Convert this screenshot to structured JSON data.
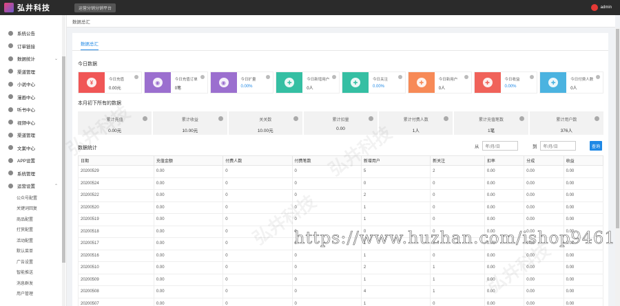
{
  "header": {
    "brand": "弘井科技",
    "platform_tag": "运营分销分销平台",
    "user": "admin"
  },
  "breadcrumb": "数据总汇",
  "sidebar": {
    "items": [
      {
        "label": "系统公告",
        "chev": ""
      },
      {
        "label": "订单链接",
        "chev": ""
      },
      {
        "label": "数据统计",
        "chev": "⌄"
      },
      {
        "label": "渠道管理",
        "chev": ""
      },
      {
        "label": "小说中心",
        "chev": ""
      },
      {
        "label": "漫画中心",
        "chev": ""
      },
      {
        "label": "听书中心",
        "chev": ""
      },
      {
        "label": "视频中心",
        "chev": ""
      },
      {
        "label": "渠道管理",
        "chev": ""
      },
      {
        "label": "文案中心",
        "chev": ""
      },
      {
        "label": "APP设置",
        "chev": ""
      },
      {
        "label": "系统管理",
        "chev": ""
      },
      {
        "label": "运营设置",
        "chev": "⌃"
      }
    ],
    "sub_items": [
      "公众号配置",
      "关键词回复",
      "商品配置",
      "打赏配置",
      "活动配置",
      "默认菜单",
      "广告设置",
      "智能推送",
      "消息群发",
      "用户管理"
    ]
  },
  "tab": "数据总汇",
  "today_title": "今日数据",
  "kpis": [
    {
      "icon": "yuan-icon",
      "color": "#f05656",
      "label": "今日充值",
      "value": "0.00元",
      "blue": false
    },
    {
      "icon": "coins-icon",
      "color": "#9b6fcf",
      "label": "今日充值订单",
      "value": "0笔",
      "blue": false
    },
    {
      "icon": "coins-icon",
      "color": "#9b6fcf",
      "label": "今日扩量",
      "value": "0.00%",
      "blue": true
    },
    {
      "icon": "add-user-icon",
      "color": "#35bfa3",
      "label": "今日新增用户",
      "value": "0人",
      "blue": false
    },
    {
      "icon": "add-user-icon",
      "color": "#35bfa3",
      "label": "今日关注",
      "value": "0.00%",
      "blue": true
    },
    {
      "icon": "users-icon",
      "color": "#f78a57",
      "label": "今日新用户",
      "value": "0人",
      "blue": false
    },
    {
      "icon": "users-icon",
      "color": "#f0625a",
      "label": "今日收益",
      "value": "0.00%",
      "blue": true
    },
    {
      "icon": "user-icon",
      "color": "#4bb3e0",
      "label": "今日付费人数",
      "value": "0人",
      "blue": false
    }
  ],
  "month_title": "本月初下所有的数据",
  "stats": [
    {
      "label": "累计充值",
      "value": "0.00元"
    },
    {
      "label": "累计收益",
      "value": "10.00元"
    },
    {
      "label": "关关数",
      "value": "10.00元"
    },
    {
      "label": "累计扣量",
      "value": "0.00"
    },
    {
      "label": "累计付费人数",
      "value": "1人"
    },
    {
      "label": "累计充值笔数",
      "value": "1笔"
    },
    {
      "label": "累计用户数",
      "value": "376人"
    }
  ],
  "table_title": "数据统计",
  "range": {
    "from_label": "从",
    "to_label": "到",
    "from_placeholder": "年/月/日",
    "to_placeholder": "年/月/日",
    "query": "查询"
  },
  "table": {
    "headers": [
      "日期",
      "充值金额",
      "付费人数",
      "付费笔数",
      "新增用户",
      "新关注",
      "扣率",
      "分成",
      "收益"
    ],
    "rows": [
      [
        "20200529",
        "0.00",
        "0",
        "0",
        "5",
        "2",
        "0.00",
        "0.00",
        "0.00"
      ],
      [
        "20200524",
        "0.00",
        "0",
        "0",
        "0",
        "0",
        "0.00",
        "0.00",
        "0.00"
      ],
      [
        "20200522",
        "0.00",
        "0",
        "0",
        "2",
        "0",
        "0.00",
        "0.00",
        "0.00"
      ],
      [
        "20200520",
        "0.00",
        "0",
        "0",
        "1",
        "0",
        "0.00",
        "0.00",
        "0.00"
      ],
      [
        "20200519",
        "0.00",
        "0",
        "0",
        "1",
        "0",
        "0.00",
        "0.00",
        "0.00"
      ],
      [
        "20200518",
        "0.00",
        "0",
        "0",
        "0",
        "0",
        "0.00",
        "0.00",
        "0.00"
      ],
      [
        "20200517",
        "0.00",
        "0",
        "0",
        "1",
        "0",
        "0.00",
        "0.00",
        "0.00"
      ],
      [
        "20200516",
        "0.00",
        "0",
        "0",
        "1",
        "0",
        "0.00",
        "0.00",
        "0.00"
      ],
      [
        "20200510",
        "0.00",
        "0",
        "0",
        "2",
        "1",
        "0.00",
        "0.00",
        "0.00"
      ],
      [
        "20200509",
        "0.00",
        "0",
        "0",
        "1",
        "1",
        "0.00",
        "0.00",
        "0.00"
      ],
      [
        "20200508",
        "0.00",
        "0",
        "0",
        "4",
        "1",
        "0.00",
        "0.00",
        "0.00"
      ],
      [
        "20200507",
        "0.00",
        "0",
        "0",
        "1",
        "0",
        "0.00",
        "0.00",
        "0.00"
      ]
    ]
  },
  "watermark_text": "弘井科技",
  "url_watermark": "https://www.huzhan.com/ishop9461"
}
